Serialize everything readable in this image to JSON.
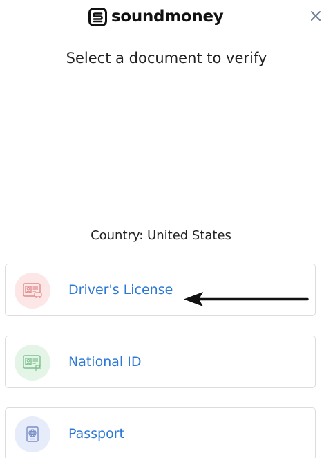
{
  "header": {
    "brand_name": "soundmoney",
    "logo_icon": "soundmoney-logo-icon",
    "close_icon": "close-icon"
  },
  "main": {
    "title": "Select a document to verify",
    "country_label": "Country: United States"
  },
  "documents": [
    {
      "label": "Driver's License",
      "icon": "drivers-license-icon",
      "icon_bg": "#fde6e6",
      "icon_color": "#e08a8a"
    },
    {
      "label": "National ID",
      "icon": "national-id-icon",
      "icon_bg": "#e4f5e8",
      "icon_color": "#7cc08e"
    },
    {
      "label": "Passport",
      "icon": "passport-icon",
      "icon_bg": "#e6ecfa",
      "icon_color": "#7a8fc8"
    }
  ],
  "annotation": {
    "arrow_icon": "left-arrow-icon"
  },
  "colors": {
    "link_blue": "#2b78d6",
    "card_border": "#dcdcdc",
    "close_gray": "#6e7f96"
  }
}
